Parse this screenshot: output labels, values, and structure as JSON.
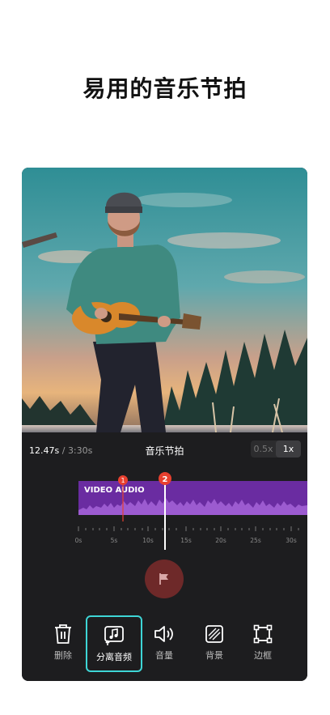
{
  "headline": "易用的音乐节拍",
  "editor": {
    "current_time": "12.47s",
    "separator": " / ",
    "total_time": "3:30s",
    "panel_title": "音乐节拍",
    "speed_options": [
      {
        "label": "0.5x",
        "active": false
      },
      {
        "label": "1x",
        "active": true
      }
    ],
    "track_label": "VIDEO AUDIO",
    "beat_markers": [
      "1",
      "2"
    ],
    "ruler_labels": [
      "0s",
      "5s",
      "10s",
      "15s",
      "20s",
      "25s",
      "30s"
    ]
  },
  "toolbar": {
    "items": [
      {
        "label": "删除",
        "icon": "trash-icon",
        "selected": false
      },
      {
        "label": "分离音频",
        "icon": "extract-audio-icon",
        "selected": true
      },
      {
        "label": "音量",
        "icon": "volume-icon",
        "selected": false
      },
      {
        "label": "背景",
        "icon": "background-icon",
        "selected": false
      },
      {
        "label": "边框",
        "icon": "border-icon",
        "selected": false
      }
    ]
  },
  "colors": {
    "accent_cyan": "#3ed6d6",
    "track_purple": "#6a2ca1",
    "marker_red": "#e8402f",
    "panel_bg": "#1d1d1f"
  }
}
